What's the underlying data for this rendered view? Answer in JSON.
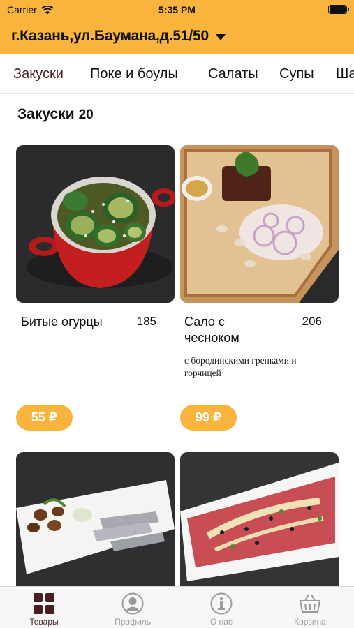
{
  "status_bar": {
    "carrier": "Carrier",
    "time": "5:35 PM"
  },
  "header": {
    "address": "г.Казань,ул.Баумана,д.51/50"
  },
  "categories": [
    {
      "label": "Закуски",
      "active": true
    },
    {
      "label": "Поке и боулы",
      "active": false
    },
    {
      "label": "Салаты",
      "active": false
    },
    {
      "label": "Супы",
      "active": false
    },
    {
      "label": "Ша",
      "active": false
    }
  ],
  "section": {
    "title": "Закуски",
    "count": "20"
  },
  "products": [
    {
      "name": "Битые огурцы",
      "weight": "185",
      "description": "",
      "price": "55 ₽",
      "image": "cucumbers-in-red-pot"
    },
    {
      "name": "Сало с чесноком",
      "weight": "206",
      "description": "с бородинскими гренками и горчицей",
      "price": "99 ₽",
      "image": "salo-on-wooden-board"
    },
    {
      "name": "",
      "weight": "",
      "description": "",
      "price": "",
      "image": "herring-with-potatoes"
    },
    {
      "name": "",
      "weight": "",
      "description": "",
      "price": "",
      "image": "beef-carpaccio"
    }
  ],
  "bottom_nav": [
    {
      "label": "Товары",
      "icon": "grid-icon",
      "active": true
    },
    {
      "label": "Профиль",
      "icon": "profile-icon",
      "active": false
    },
    {
      "label": "О нас",
      "icon": "info-icon",
      "active": false
    },
    {
      "label": "Корзина",
      "icon": "basket-icon",
      "active": false
    }
  ],
  "colors": {
    "accent": "#f8b43c",
    "active_tab": "#4a1f1f",
    "inactive_nav": "#9a9a9a"
  }
}
